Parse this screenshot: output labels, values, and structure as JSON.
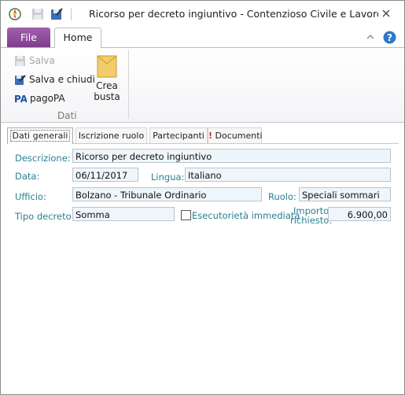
{
  "window": {
    "title": "Ricorso per decreto ingiuntivo - Contenzioso Civile e Lavoro - atti..."
  },
  "quick_access": {
    "icons": [
      "app-emblem-icon",
      "save-icon",
      "save-close-icon"
    ]
  },
  "ribbon": {
    "tabs": {
      "file": "File",
      "home": "Home"
    },
    "group_name": "Dati",
    "buttons": {
      "salva": "Salva",
      "salva_chiudi": "Salva e chiudi",
      "pagopa": "pagoPA",
      "crea_busta_1": "Crea",
      "crea_busta_2": "busta"
    }
  },
  "doc_tabs": {
    "dati_generali": "Dati generali",
    "iscrizione_ruolo": "Iscrizione ruolo",
    "partecipanti": "Partecipanti",
    "documenti": "Documenti",
    "documenti_alert": "!"
  },
  "form": {
    "descrizione": {
      "label": "Descrizione:",
      "value": "Ricorso per decreto ingiuntivo"
    },
    "data": {
      "label": "Data:",
      "value": "06/11/2017"
    },
    "lingua": {
      "label": "Lingua:",
      "value": "Italiano"
    },
    "ufficio": {
      "label": "Ufficio:",
      "value": "Bolzano - Tribunale Ordinario"
    },
    "ruolo": {
      "label": "Ruolo:",
      "value": "Speciali sommari"
    },
    "tipo_decreto": {
      "label": "Tipo decreto:",
      "value": "Somma"
    },
    "esecutorieta": {
      "label": "Esecutorietà immediata",
      "checked": false
    },
    "importo": {
      "label_1": "Importo",
      "label_2": "richiesto:",
      "value": "6.900,00"
    }
  },
  "colors": {
    "file_tab": "#8c4a99",
    "label_teal": "#2a7f92",
    "field_bg": "#eff6fb",
    "alert_red": "#e02020"
  }
}
